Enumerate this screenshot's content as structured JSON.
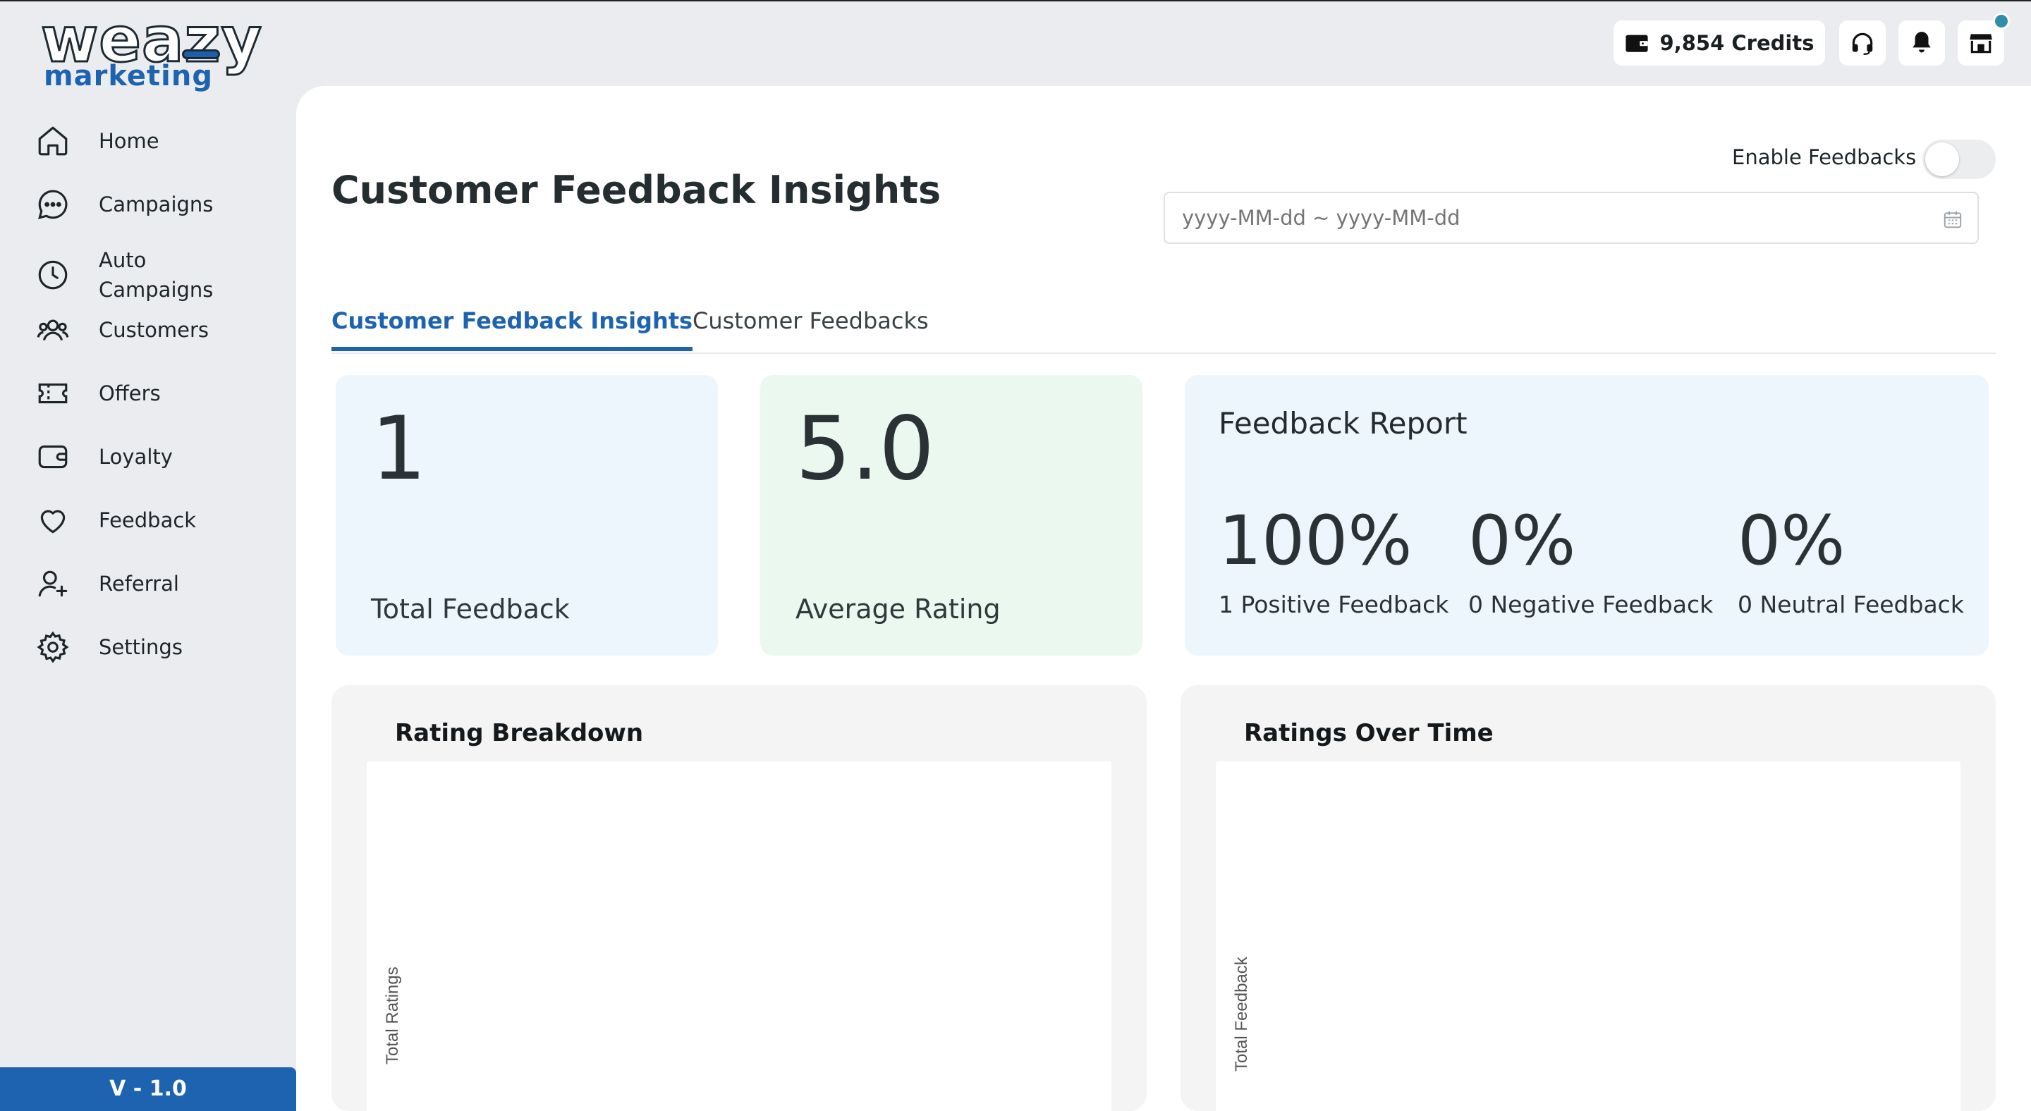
{
  "app": {
    "logo_top": "weazy",
    "logo_bottom": "marketing",
    "version": "V - 1.0"
  },
  "sidebar": {
    "items": [
      {
        "label": "Home",
        "icon": "home-icon"
      },
      {
        "label": "Campaigns",
        "icon": "chat-icon"
      },
      {
        "label": "Auto Campaigns",
        "icon": "clock-icon"
      },
      {
        "label": "Customers",
        "icon": "users-icon"
      },
      {
        "label": "Offers",
        "icon": "ticket-icon"
      },
      {
        "label": "Loyalty",
        "icon": "wallet-icon"
      },
      {
        "label": "Feedback",
        "icon": "heart-icon"
      },
      {
        "label": "Referral",
        "icon": "user-plus-icon"
      },
      {
        "label": "Settings",
        "icon": "gear-icon"
      }
    ]
  },
  "topbar": {
    "credits": "9,854 Credits",
    "icons": [
      "wallet-icon",
      "headset-icon",
      "bell-icon",
      "store-icon"
    ]
  },
  "page": {
    "title": "Customer Feedback Insights",
    "enable_feedbacks_label": "Enable Feedbacks",
    "enable_feedbacks_on": false,
    "date_placeholder": "yyyy-MM-dd ~ yyyy-MM-dd"
  },
  "tabs": [
    {
      "label": "Customer Feedback Insights",
      "active": true
    },
    {
      "label": "Customer Feedbacks",
      "active": false
    }
  ],
  "stats": {
    "total_feedback": {
      "value": "1",
      "label": "Total Feedback"
    },
    "average_rating": {
      "value": "5.0",
      "label": "Average Rating"
    }
  },
  "report": {
    "title": "Feedback Report",
    "items": [
      {
        "percent": "100%",
        "label": "1 Positive Feedback"
      },
      {
        "percent": "0%",
        "label": "0 Negative Feedback"
      },
      {
        "percent": "0%",
        "label": "0 Neutral Feedback"
      }
    ]
  },
  "charts": {
    "rating_breakdown": {
      "title": "Rating Breakdown",
      "ylabel": "Total Ratings"
    },
    "ratings_over_time": {
      "title": "Ratings Over Time",
      "ylabel": "Total Feedback"
    }
  },
  "colors": {
    "accent": "#1e63b0",
    "card_blue": "#eef6fd",
    "card_green": "#eaf8ef",
    "notification_dot": "#2f8fa8"
  }
}
